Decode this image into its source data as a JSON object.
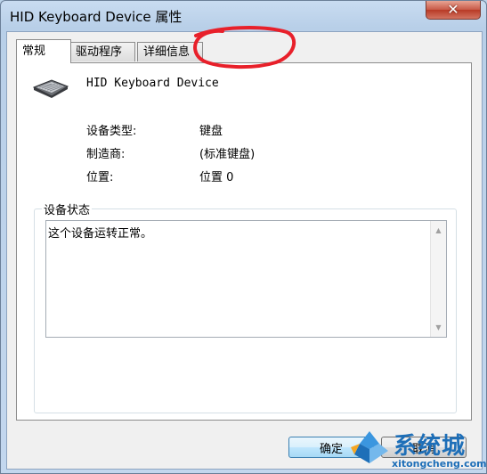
{
  "window": {
    "title": "HID Keyboard Device 属性",
    "close_glyph": "✕"
  },
  "tabs": [
    {
      "label": "常规",
      "active": true
    },
    {
      "label": "驱动程序",
      "active": false
    },
    {
      "label": "详细信息",
      "active": false
    }
  ],
  "device": {
    "name": "HID Keyboard Device",
    "icon": "keyboard-icon"
  },
  "properties": [
    {
      "label": "设备类型:",
      "value": "键盘"
    },
    {
      "label": "制造商:",
      "value": "(标准键盘)"
    },
    {
      "label": "位置:",
      "value": "位置 0"
    }
  ],
  "status": {
    "group_label": "设备状态",
    "text": "这个设备运转正常。"
  },
  "buttons": {
    "ok": "确定",
    "cancel": "取消"
  },
  "watermark": {
    "brand": "系统城",
    "url": "xitongcheng.com"
  },
  "colors": {
    "annotation": "#e8202a",
    "watermark": "#1e6fb8"
  }
}
